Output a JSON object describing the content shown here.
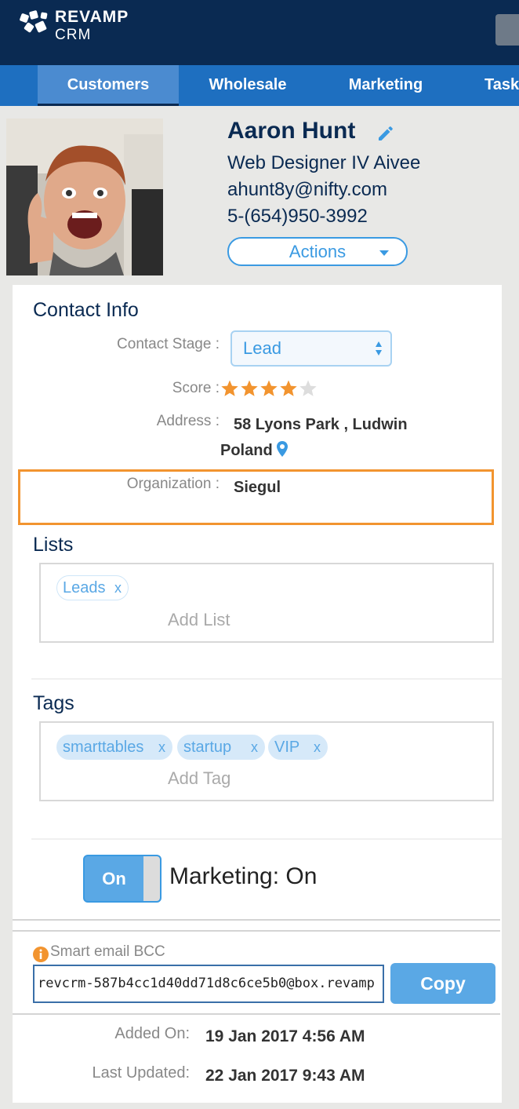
{
  "app": {
    "brand_line1": "REVAMP",
    "brand_line2": "CRM"
  },
  "nav": {
    "items": [
      {
        "label": "Customers",
        "active": true
      },
      {
        "label": "Wholesale",
        "active": false
      },
      {
        "label": "Marketing",
        "active": false
      },
      {
        "label": "Tasks",
        "active": false
      }
    ]
  },
  "contact": {
    "name": "Aaron Hunt",
    "title": "Web Designer IV Aivee",
    "email": "ahunt8y@nifty.com",
    "phone": "5-(654)950-3992",
    "actions_label": "Actions"
  },
  "contact_info": {
    "heading": "Contact Info",
    "stage_label": "Contact Stage :",
    "stage_value": "Lead",
    "score_label": "Score :",
    "score": 4,
    "score_max": 5,
    "address_label": "Address :",
    "address_line1": "58 Lyons Park , Ludwin",
    "address_line2": "Poland",
    "organization_label": "Organization :",
    "organization_value": "Siegul"
  },
  "lists": {
    "heading": "Lists",
    "items": [
      "Leads"
    ],
    "remove_symbol": "x",
    "add_placeholder": "Add List"
  },
  "tags": {
    "heading": "Tags",
    "items": [
      "smarttables",
      "startup",
      "VIP"
    ],
    "remove_symbol": "x",
    "add_placeholder": "Add Tag"
  },
  "marketing": {
    "toggle_label": "On",
    "status_text": "Marketing: On"
  },
  "bcc": {
    "label": "Smart email BCC",
    "address": "revcrm-587b4cc1d40dd71d8c6ce5b0@box.revamp",
    "copy_label": "Copy"
  },
  "meta": {
    "added_label": "Added On:",
    "added_value": "19 Jan 2017 4:56 AM",
    "updated_label": "Last Updated:",
    "updated_value": "22 Jan 2017 9:43 AM"
  },
  "colors": {
    "topbar": "#0a2a52",
    "nav": "#1e6fc0",
    "accent": "#3a9ae2",
    "star": "#f2942f",
    "highlight_border": "#f2942f"
  },
  "icons": [
    "revamp-logo-icon",
    "pencil-icon",
    "chevron-down-icon",
    "updown-arrows-icon",
    "star-icon",
    "map-pin-icon",
    "info-icon",
    "close-icon"
  ]
}
